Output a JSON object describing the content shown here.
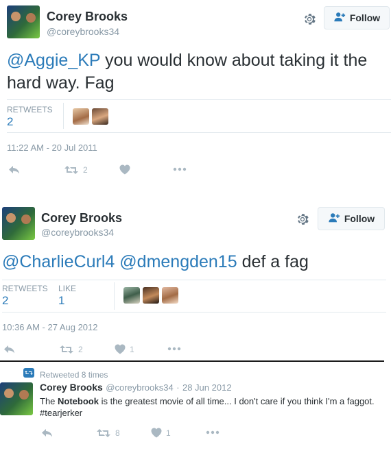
{
  "tweet1": {
    "name": "Corey Brooks",
    "handle": "@coreybrooks34",
    "follow_label": "Follow",
    "mention": "@Aggie_KP",
    "text_rest": " you would know about taking it the hard way. Fag",
    "stats": {
      "retweets_label": "RETWEETS",
      "retweets_value": "2"
    },
    "time": "11:22 AM - 20 Jul 2011",
    "actions": {
      "retweet_count": "2"
    }
  },
  "tweet2": {
    "name": "Corey Brooks",
    "handle": "@coreybrooks34",
    "follow_label": "Follow",
    "mention1": "@CharlieCurl4",
    "mention2": "@dmengden15",
    "text_rest": " def a fag",
    "stats": {
      "retweets_label": "RETWEETS",
      "retweets_value": "2",
      "likes_label": "LIKE",
      "likes_value": "1"
    },
    "time": "10:36 AM - 27 Aug 2012",
    "actions": {
      "retweet_count": "2",
      "like_count": "1"
    }
  },
  "tweet3": {
    "retweeted_label": "Retweeted 8 times",
    "name": "Corey Brooks",
    "handle": "@coreybrooks34",
    "dot": "·",
    "date": "28 Jun 2012",
    "text_pre": "The ",
    "text_bold": "Notebook",
    "text_rest": " is the greatest movie of all time... I don't care if you think I'm a faggot. #tearjerker",
    "actions": {
      "retweet_count": "8",
      "like_count": "1"
    }
  },
  "colors": {
    "link": "#2b7bb9",
    "muted": "#8899a6",
    "icon": "#aab8c2",
    "border": "#e1e8ed"
  },
  "icons": [
    "gear-icon",
    "follow-person-icon",
    "reply-icon",
    "retweet-icon",
    "like-icon",
    "more-icon",
    "retweeted-icon"
  ]
}
